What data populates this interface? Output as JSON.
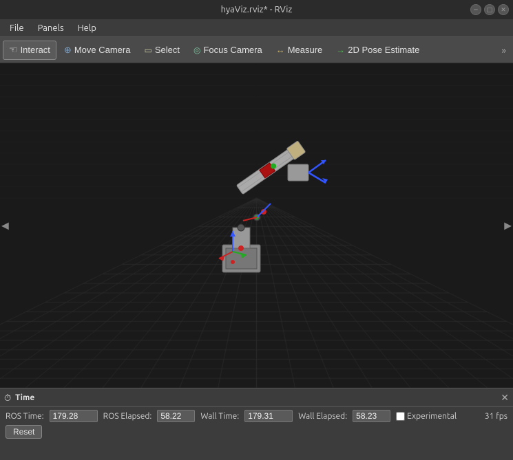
{
  "titlebar": {
    "title": "hyaViz.rviz* - RViz",
    "controls": [
      "minimize",
      "maximize",
      "close"
    ]
  },
  "menubar": {
    "items": [
      "File",
      "Panels",
      "Help"
    ]
  },
  "toolbar": {
    "tools": [
      {
        "id": "interact",
        "label": "Interact",
        "icon": "hand-icon",
        "active": true
      },
      {
        "id": "move-camera",
        "label": "Move Camera",
        "icon": "move-camera-icon",
        "active": false
      },
      {
        "id": "select",
        "label": "Select",
        "icon": "select-icon",
        "active": false
      },
      {
        "id": "focus-camera",
        "label": "Focus Camera",
        "icon": "focus-camera-icon",
        "active": false
      },
      {
        "id": "measure",
        "label": "Measure",
        "icon": "measure-icon",
        "active": false
      },
      {
        "id": "pose-estimate",
        "label": "2D Pose Estimate",
        "icon": "pose-estimate-icon",
        "active": false
      }
    ],
    "more_label": "»"
  },
  "viewport": {
    "background_color": "#1a1a1a"
  },
  "statusbar": {
    "icon": "clock-icon",
    "title": "Time",
    "close_label": "✕"
  },
  "bottombar": {
    "ros_time_label": "ROS Time:",
    "ros_time_value": "179.28",
    "ros_elapsed_label": "ROS Elapsed:",
    "ros_elapsed_value": "58.22",
    "wall_time_label": "Wall Time:",
    "wall_time_value": "179.31",
    "wall_elapsed_label": "Wall Elapsed:",
    "wall_elapsed_value": "58.23",
    "experimental_label": "Experimental",
    "fps_label": "31 fps",
    "reset_label": "Reset"
  }
}
